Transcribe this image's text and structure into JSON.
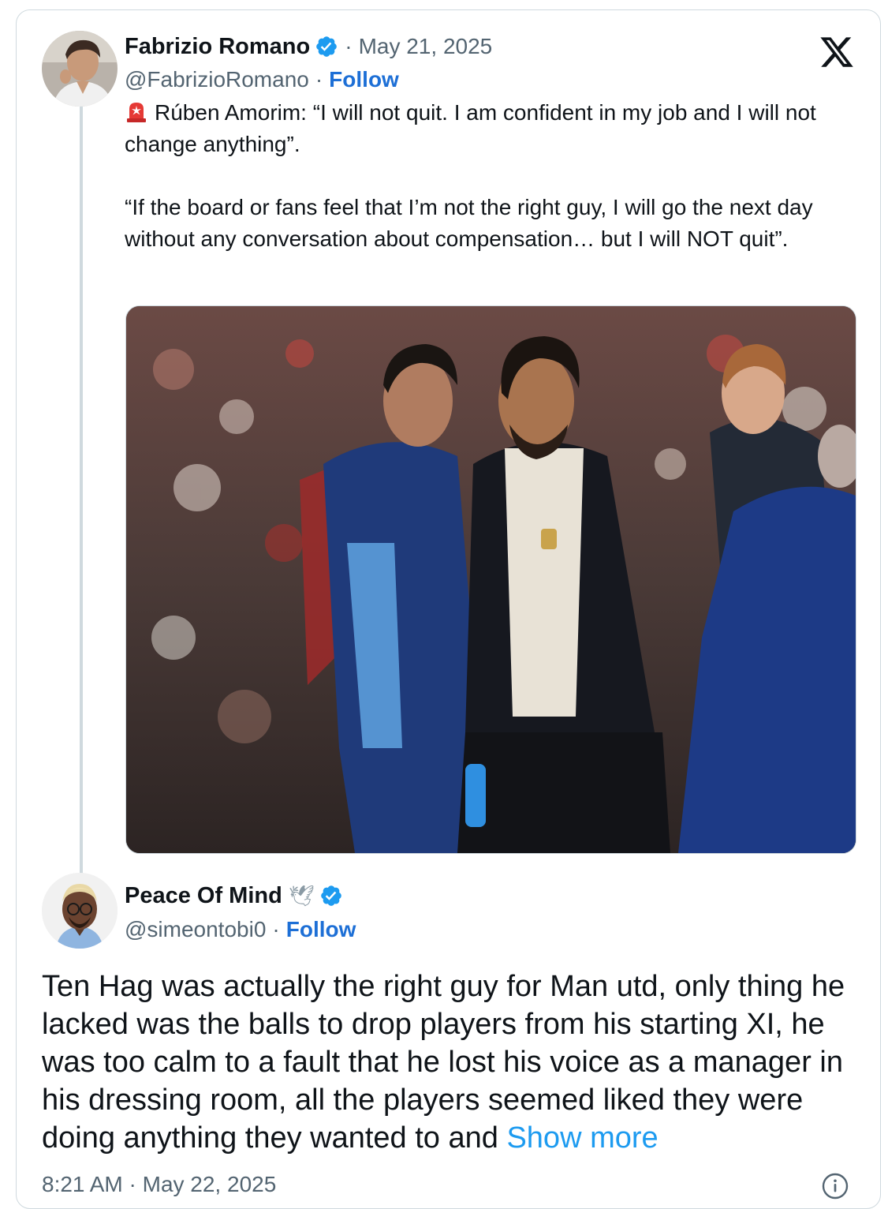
{
  "tweet": {
    "author": {
      "name": "Fabrizio Romano",
      "handle": "@FabrizioRomano",
      "verified": true
    },
    "date": "May 21, 2025",
    "follow_label": "Follow",
    "separator": "·",
    "emoji": "siren",
    "text_line1": "Rúben Amorim: “I will not quit. I am confident in my job and I will not change anything”.",
    "text_line2": "“If the board or fans feel that I’m not the right guy, I will go the next day without any conversation about compensation… but I will NOT quit”.",
    "media": {
      "type": "photo"
    }
  },
  "reply": {
    "author": {
      "name": "Peace Of Mind",
      "name_emoji": "🕊",
      "handle": "@simeontobi0",
      "verified": true
    },
    "follow_label": "Follow",
    "separator": "·",
    "text": "Ten Hag was actually the right guy for Man utd, only thing he lacked was the balls to drop players from his starting XI, he was too calm to a fault that he lost his voice as a manager in his dressing room, all the players seemed liked they were doing anything they wanted to and",
    "show_more_label": "Show more",
    "timestamp": "8:21 AM · May 22, 2025"
  },
  "icons": {
    "logo": "x-logo-icon",
    "verified": "verified-badge-icon",
    "info": "info-icon"
  },
  "colors": {
    "link": "#1d9bf0",
    "follow": "#1d6fd6",
    "verified": "#1d9bf0",
    "secondary_text": "#536471",
    "border": "#cfd9de"
  }
}
